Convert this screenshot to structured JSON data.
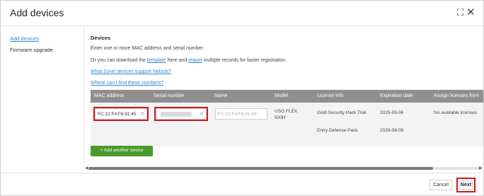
{
  "dialog": {
    "title": "Add devices",
    "expand_icon": "expand-icon",
    "close_icon": "close-icon"
  },
  "sidebar": {
    "items": [
      {
        "label": "Add devices",
        "active": true
      },
      {
        "label": "Firmware upgrade",
        "active": false
      }
    ]
  },
  "main": {
    "section_title": "Devices",
    "intro": "Enter one or more MAC address and serial number.",
    "download_prefix": "Or you can download the ",
    "template_link": "template",
    "download_middle": " here and ",
    "import_link": "import",
    "download_suffix": " multiple records for faster registration.",
    "support_link": "What Zyxel devices support Nebula?",
    "find_link": "Where can I find these numbers?"
  },
  "table": {
    "columns": [
      "MAC address",
      "Serial number",
      "Name",
      "Model",
      "License info",
      "Expiration date",
      "Assign licenses from"
    ],
    "row": {
      "mac": "FC:22:F4:F6:91:45",
      "serial": "",
      "name_placeholder": "FC:22:F4:F6:91:45",
      "model_line1": "USG FLEX",
      "model_line2": "500H",
      "licenses": [
        {
          "name": "Gold Security Pack Trial",
          "expiration": "2025-09-06",
          "assign": "No available licenses"
        },
        {
          "name": "Entry Defense Pack",
          "expiration": "2026-08-08",
          "assign": ""
        }
      ]
    }
  },
  "add_button": {
    "icon": "plus-icon",
    "label": "+ Add another device"
  },
  "footer": {
    "cancel": "Cancel",
    "next": "Next"
  },
  "colors": {
    "link": "#2a8bd0",
    "header_bg": "#8f8f8f",
    "add_button": "#4a9a2c",
    "highlight": "#d0191f"
  }
}
